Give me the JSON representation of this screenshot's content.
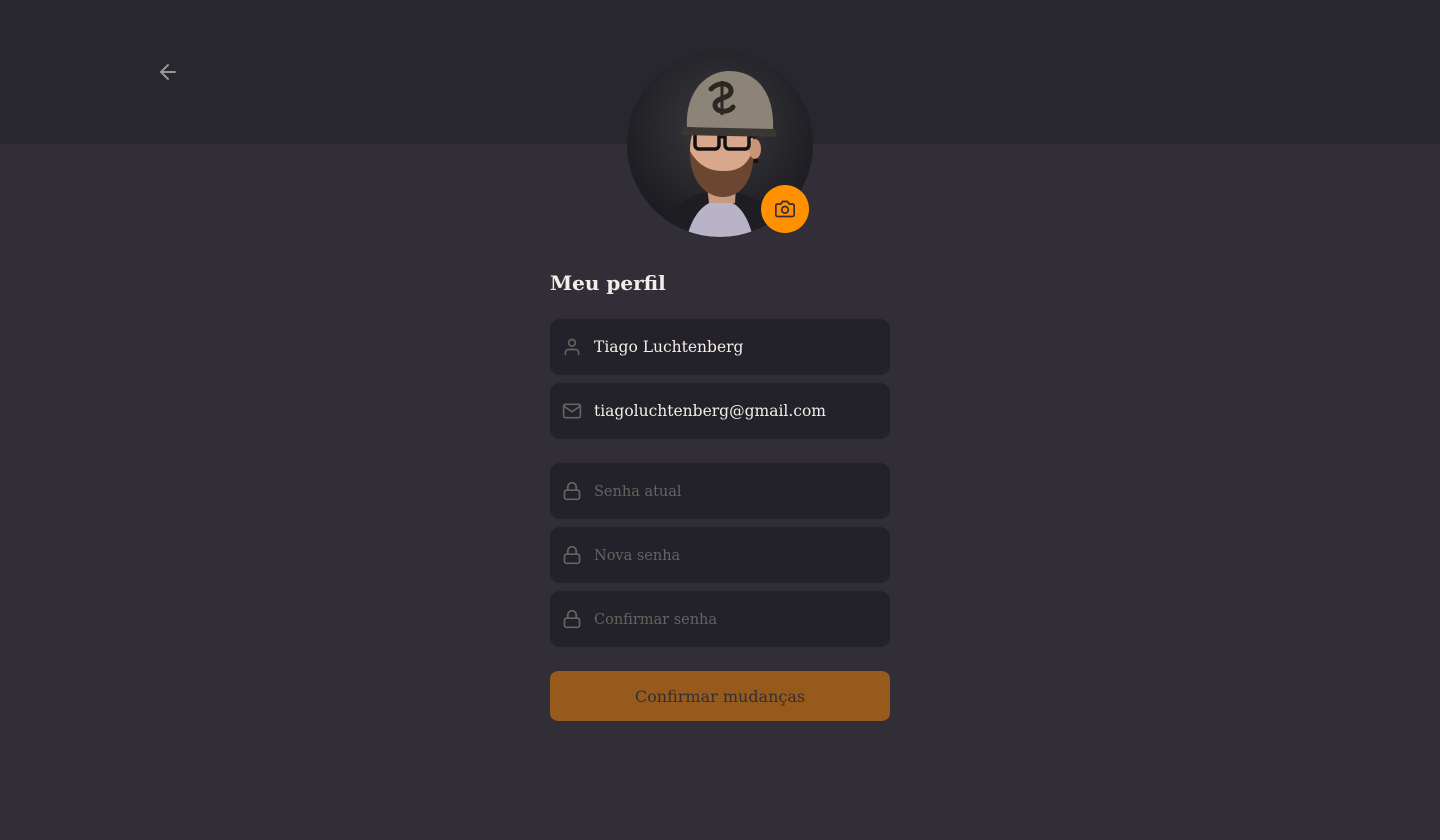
{
  "header": {
    "back_icon": "arrow-left-icon"
  },
  "avatar": {
    "description_icon": "camera-icon",
    "accent_color": "#ff9000"
  },
  "profile": {
    "title": "Meu perfil",
    "name_value": "Tiago Luchtenberg",
    "email_value": "tiagoluchtenberg@gmail.com",
    "current_password_placeholder": "Senha atual",
    "new_password_placeholder": "Nova senha",
    "confirm_password_placeholder": "Confirmar senha",
    "submit_label": "Confirmar mudanças"
  },
  "colors": {
    "background": "#312e38",
    "header": "#28262e",
    "input": "#232129",
    "accent": "#ff9000",
    "button": "#965b1c"
  }
}
